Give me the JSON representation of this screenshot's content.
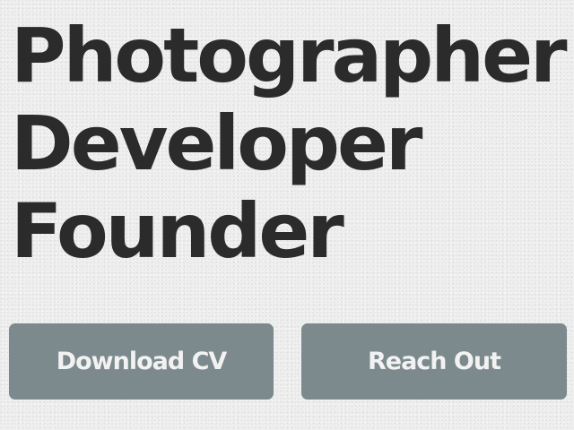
{
  "hero": {
    "lines": [
      "Photographer",
      "Developer",
      "Founder"
    ]
  },
  "actions": {
    "download_label": "Download CV",
    "reach_label": "Reach Out"
  },
  "colors": {
    "background": "#efefef",
    "text": "#2b2b2b",
    "button_bg": "#7c8a8d",
    "button_text": "#f2f2f2"
  }
}
